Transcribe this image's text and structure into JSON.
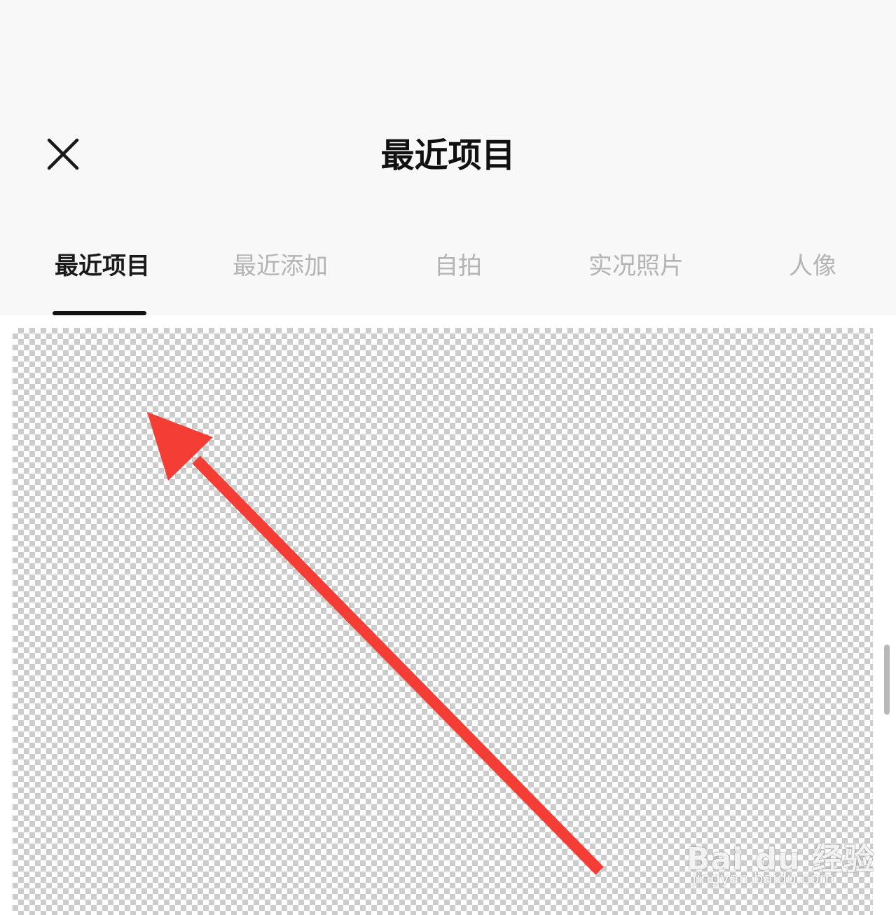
{
  "header": {
    "title": "最近项目",
    "close_icon": "close-icon"
  },
  "tabs": [
    {
      "label": "最近项目",
      "active": true
    },
    {
      "label": "最近添加",
      "active": false
    },
    {
      "label": "自拍",
      "active": false
    },
    {
      "label": "实况照片",
      "active": false
    },
    {
      "label": "人像",
      "active": false
    }
  ],
  "watermark": {
    "main": "Bai du 经验",
    "sub": "jingyan.baidu.com"
  },
  "colors": {
    "background": "#f8f8f8",
    "active_tab": "#1a1a1a",
    "inactive_tab": "#b4b4b4",
    "arrow": "#f43d35"
  }
}
